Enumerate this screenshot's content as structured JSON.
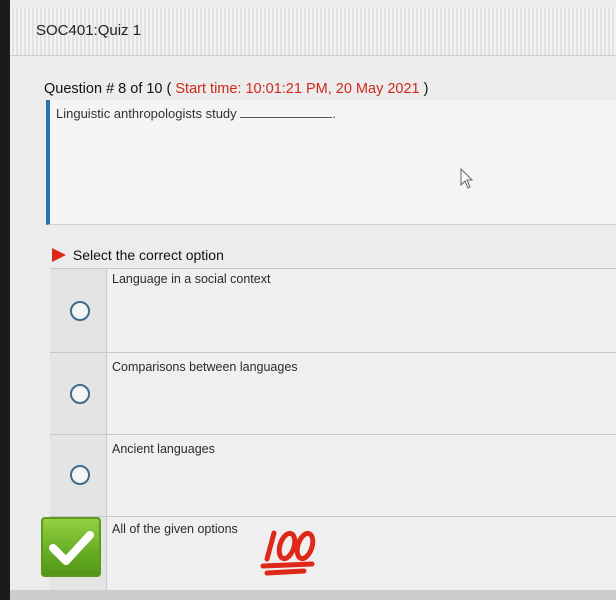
{
  "header": {
    "title": "SOC401:Quiz 1"
  },
  "question": {
    "label": "Question # 8 of 10 (",
    "start_time": "Start time: 10:01:21 PM, 20 May 2021",
    "close_paren": ")",
    "text": "Linguistic anthropologists study",
    "blank_suffix": "."
  },
  "instruction": "Select the correct option",
  "options": [
    {
      "label": "Language in a social context",
      "selected": false
    },
    {
      "label": "Comparisons between languages",
      "selected": false
    },
    {
      "label": "Ancient languages",
      "selected": false
    },
    {
      "label": "All of the given options",
      "selected": true
    }
  ],
  "icons": {
    "instruction_flag": "red-flag-icon",
    "correct_mark": "green-checkmark-icon",
    "sticker": "hundred-points-emoji-icon",
    "pointer": "mouse-cursor-icon"
  },
  "colors": {
    "start_time": "#d0281c",
    "question_border": "#2a72a6",
    "radio": "#3d6d8c",
    "check_green": "#6ab024",
    "hundred_red": "#e0281a"
  }
}
